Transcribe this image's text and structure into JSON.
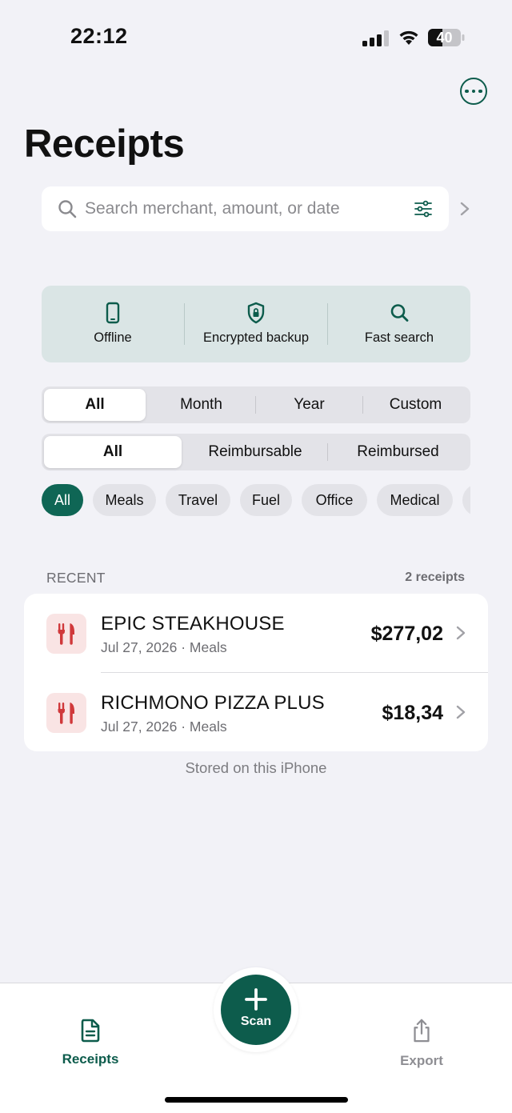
{
  "status_bar": {
    "time": "22:12",
    "battery": "40"
  },
  "header": {
    "title": "Receipts"
  },
  "search": {
    "placeholder": "Search merchant, amount, or date"
  },
  "features": [
    {
      "label": "Offline",
      "icon": "phone-icon"
    },
    {
      "label": "Encrypted backup",
      "icon": "shield-lock-icon"
    },
    {
      "label": "Fast search",
      "icon": "search-icon"
    }
  ],
  "period_filter": {
    "options": [
      "All",
      "Month",
      "Year",
      "Custom"
    ],
    "selected": "All"
  },
  "status_filter": {
    "options": [
      "All",
      "Reimbursable",
      "Reimbursed"
    ],
    "selected": "All"
  },
  "categories": {
    "items": [
      "All",
      "Meals",
      "Travel",
      "Fuel",
      "Office",
      "Medical"
    ],
    "selected": "All"
  },
  "recent": {
    "label": "RECENT",
    "count": "2 receipts",
    "items": [
      {
        "merchant": "EPIC STEAKHOUSE",
        "date": "Jul 27, 2026",
        "category": "Meals",
        "amount": "$277,02"
      },
      {
        "merchant": "RICHMONO PIZZA PLUS",
        "date": "Jul 27, 2026",
        "category": "Meals",
        "amount": "$18,34"
      }
    ],
    "footer": "Stored on this iPhone"
  },
  "tabbar": {
    "receipts_label": "Receipts",
    "scan_label": "Scan",
    "export_label": "Export"
  },
  "colors": {
    "accent": "#0d5c4c",
    "chip_active": "#0f6655",
    "meal_icon": "#d0393b",
    "meal_icon_bg": "#f9e4e4",
    "feature_bg": "#dae5e5"
  }
}
